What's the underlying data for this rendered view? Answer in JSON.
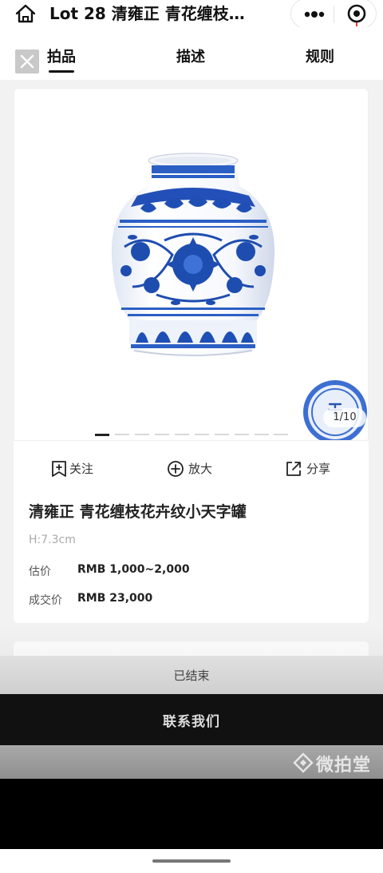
{
  "topbar": {
    "title": "Lot 28 清雍正 青花缠枝…",
    "home_icon": "home-icon",
    "more_icon": "more-dots-icon",
    "scan_icon": "scan-target-icon"
  },
  "tabs": [
    {
      "label": "拍品",
      "active": true
    },
    {
      "label": "描述",
      "active": false
    },
    {
      "label": "规则",
      "active": false
    }
  ],
  "gallery": {
    "counter": "1/10",
    "current_index": 1,
    "total": 10
  },
  "actions": {
    "follow": "关注",
    "zoom": "放大",
    "share": "分享"
  },
  "lot": {
    "name": "清雍正 青花缠枝花卉纹小天字罐",
    "dimension": "H:7.3cm",
    "estimate_label": "估价",
    "estimate_value": "RMB 1,000~2,000",
    "sold_label": "成交价",
    "sold_value": "RMB 23,000"
  },
  "footer": {
    "status": "已结束",
    "contact": "联系我们",
    "watermark": "微拍堂"
  },
  "colors": {
    "accent": "#111111",
    "blue_porcelain": "#1f4fb5",
    "contact_bg": "#111111"
  }
}
